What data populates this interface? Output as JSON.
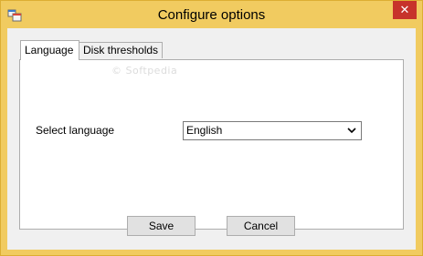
{
  "window": {
    "title": "Configure options",
    "close_glyph": "✕"
  },
  "tabs": [
    {
      "label": "Language",
      "active": true
    },
    {
      "label": "Disk thresholds",
      "active": false
    }
  ],
  "watermark": "© Softpedia",
  "language": {
    "label": "Select language",
    "selected": "English"
  },
  "buttons": {
    "save": "Save",
    "cancel": "Cancel"
  },
  "colors": {
    "frame": "#f1cb60",
    "close": "#c7332b",
    "client": "#f0f0f0"
  }
}
